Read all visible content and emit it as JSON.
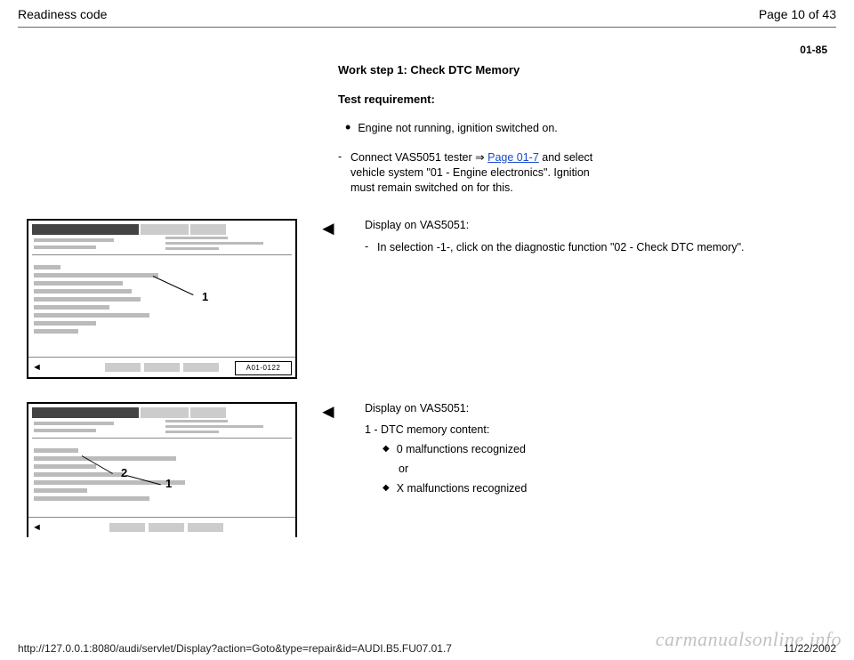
{
  "header": {
    "title": "Readiness code",
    "page_label": "Page 10 of 43"
  },
  "page_ref": "01-85",
  "intro": {
    "heading": "Work step 1: Check DTC Memory",
    "requirement_label": "Test requirement:",
    "bullet": "Engine not running, ignition switched on.",
    "dash_prefix": "Connect VAS5051 tester  ",
    "dash_link": "Page 01-7",
    "dash_suffix": " and select vehicle system \"01 - Engine electronics\". Ignition must remain switched on for this."
  },
  "section1": {
    "arrow": "◄",
    "label": "Display on VAS5051:",
    "dash_text": "In selection -1-, click on the diagnostic function \"02 - Check DTC memory\".",
    "diagram_code": "A01-0122",
    "callout": "1"
  },
  "section2": {
    "arrow": "◄",
    "label": "Display on VAS5051:",
    "line1": "1 - DTC memory content:",
    "item1": "0 malfunctions recognized",
    "or_label": "or",
    "item2": "X malfunctions recognized",
    "callout_1": "1",
    "callout_2": "2"
  },
  "footer": {
    "url": "http://127.0.0.1:8080/audi/servlet/Display?action=Goto&type=repair&id=AUDI.B5.FU07.01.7",
    "date": "11/22/2002"
  },
  "watermark": "carmanualsonline.info"
}
